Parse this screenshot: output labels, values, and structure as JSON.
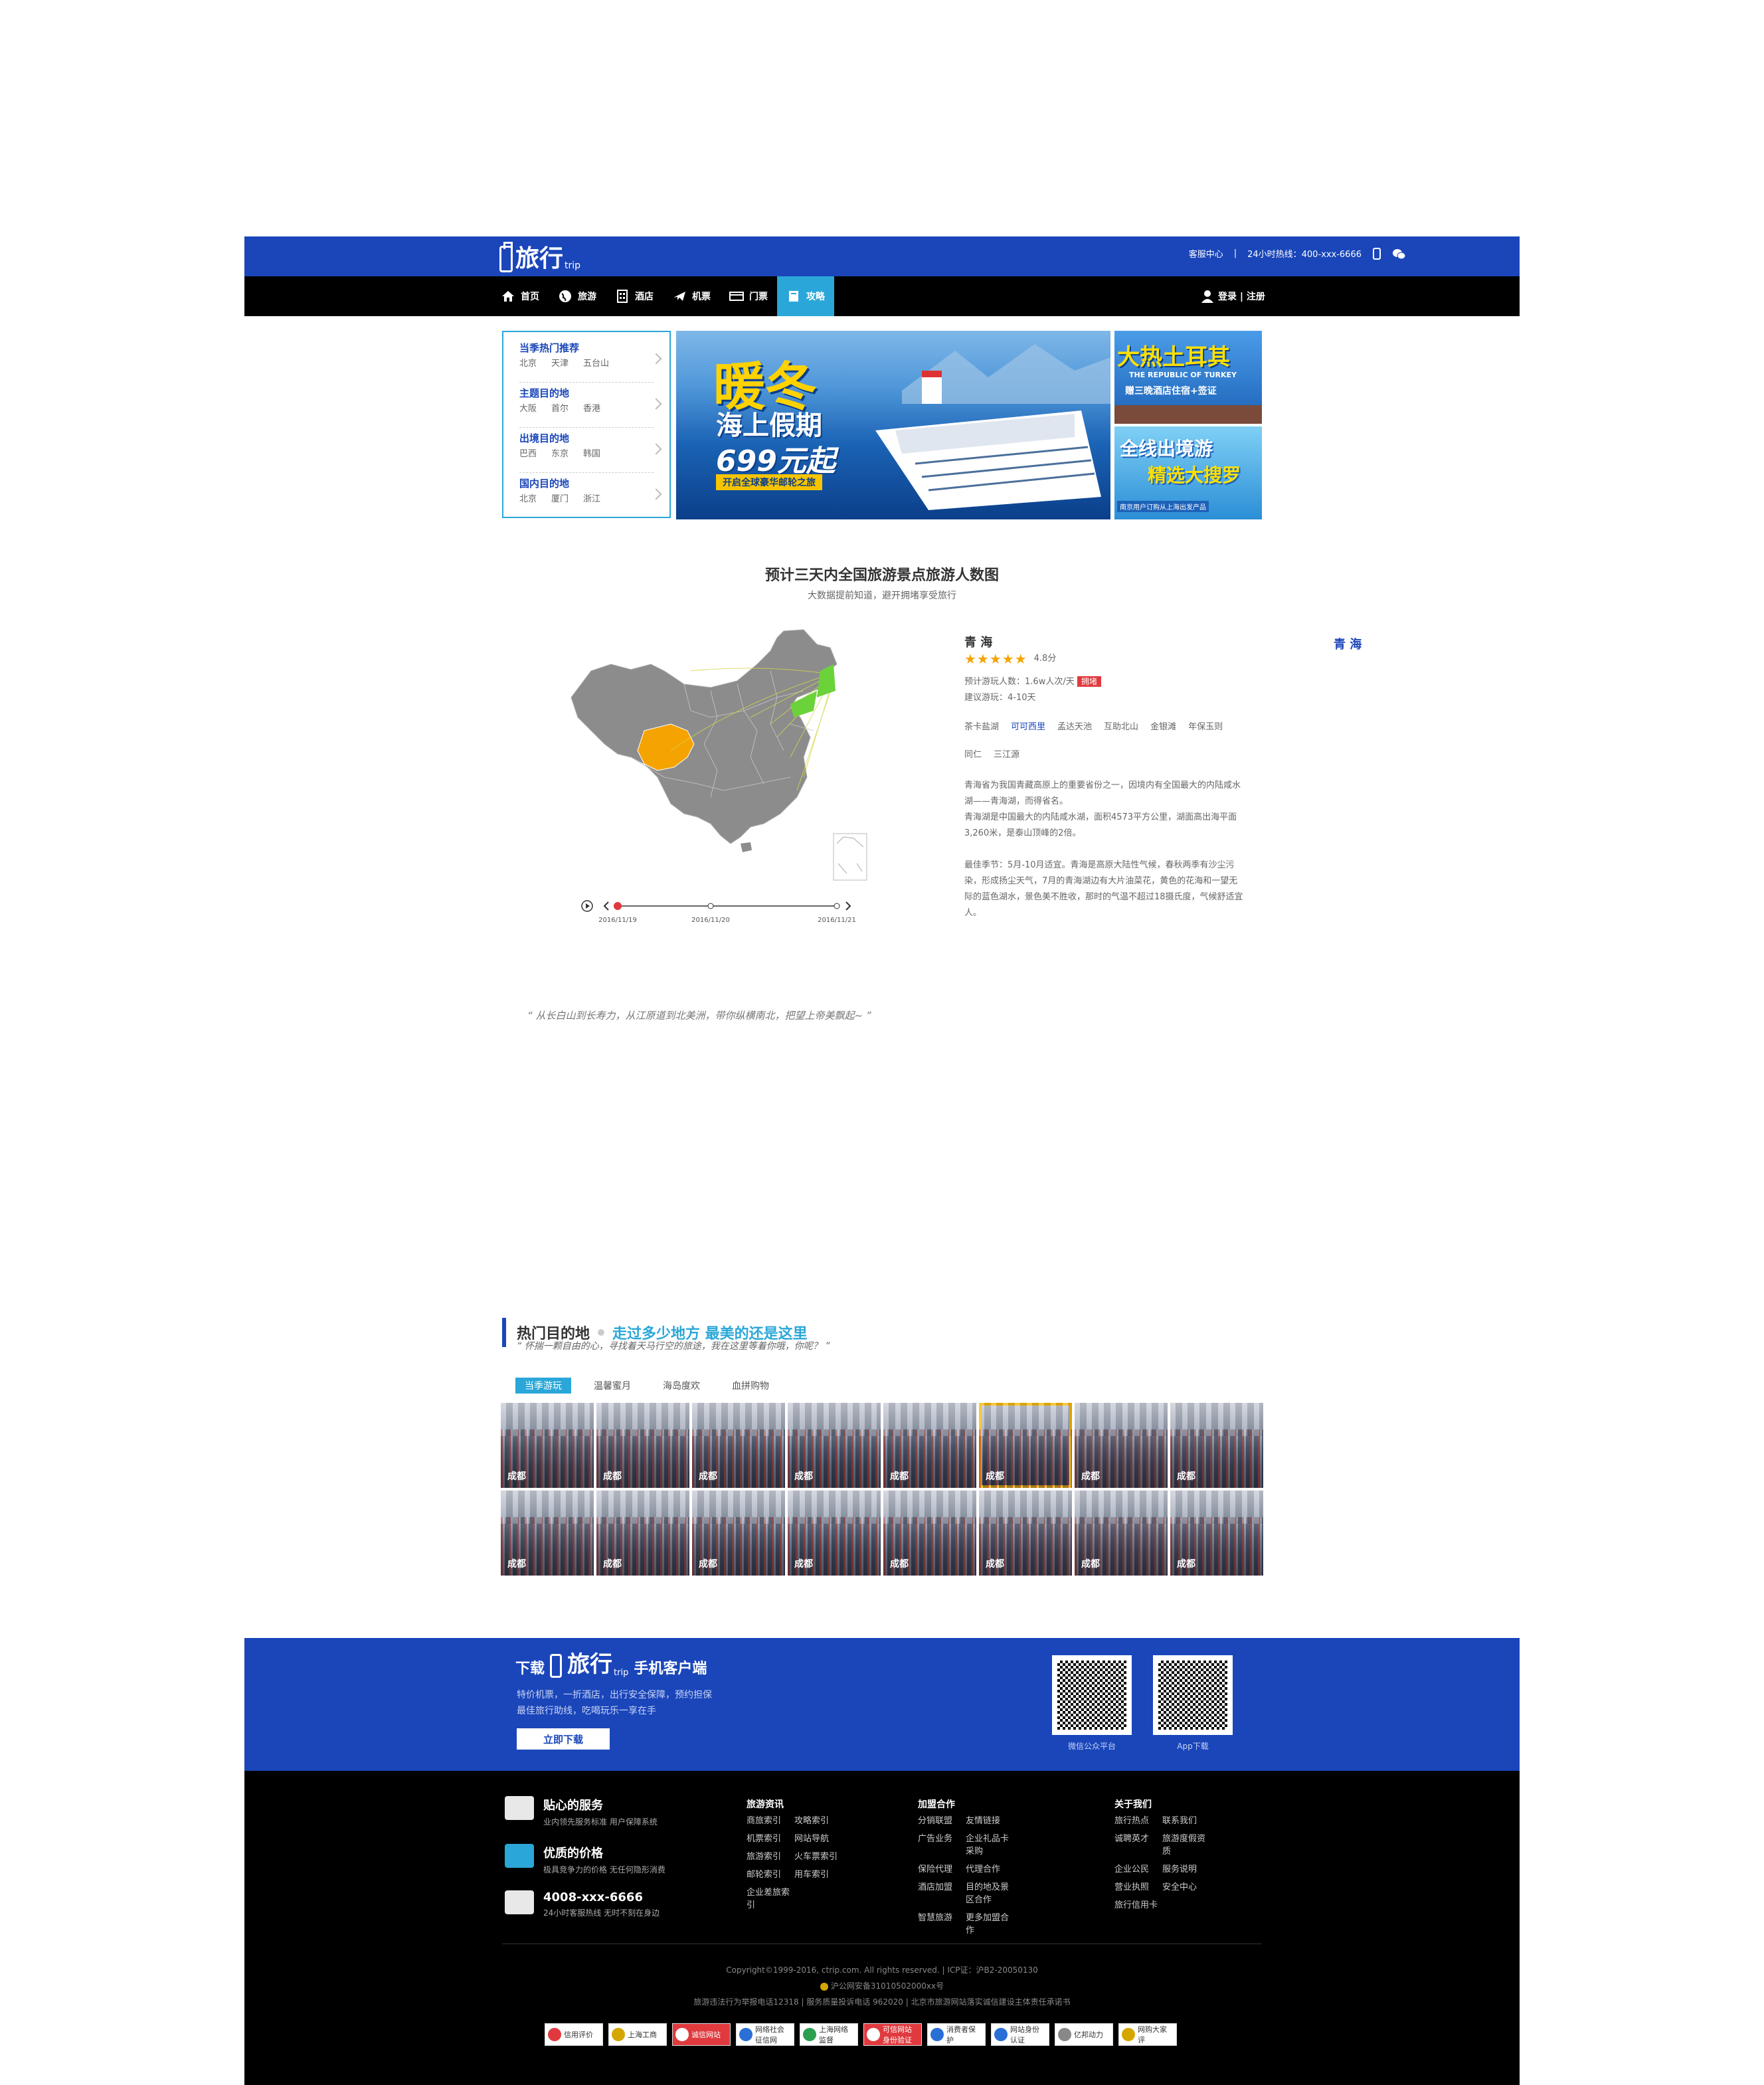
{
  "header": {
    "logo_name": "旅行",
    "logo_sub": "trip",
    "service_center": "客服中心",
    "separator": "|",
    "hotline": "24小时热线：400-xxx-6666"
  },
  "nav": {
    "items": [
      {
        "label": "首页",
        "icon": "home-icon"
      },
      {
        "label": "旅游",
        "icon": "globe-icon"
      },
      {
        "label": "酒店",
        "icon": "hotel-icon"
      },
      {
        "label": "机票",
        "icon": "plane-icon"
      },
      {
        "label": "门票",
        "icon": "ticket-icon"
      },
      {
        "label": "攻略",
        "icon": "book-icon",
        "active": true
      }
    ],
    "login": "登录 | 注册"
  },
  "categories": [
    {
      "title": "当季热门推荐",
      "cities": [
        "北京",
        "天津",
        "五台山"
      ]
    },
    {
      "title": "主题目的地",
      "cities": [
        "大阪",
        "首尔",
        "香港"
      ]
    },
    {
      "title": "出境目的地",
      "cities": [
        "巴西",
        "东京",
        "韩国"
      ]
    },
    {
      "title": "国内目的地",
      "cities": [
        "北京",
        "厦门",
        "浙江"
      ]
    }
  ],
  "banner": {
    "headline": "暖冬",
    "subline": "海上假期",
    "price": "699元起",
    "tagline": "开启全球豪华邮轮之旅"
  },
  "side_banners": [
    {
      "title": "大热土耳其",
      "sub": "THE REPUBLIC OF TURKEY",
      "note": "赠三晚酒店住宿+签证"
    },
    {
      "title": "全线出境游",
      "sub": "精选大搜罗",
      "note": "南京用户订购从上海出发产品"
    }
  ],
  "map_section": {
    "title": "预计三天内全国旅游景点旅游人数图",
    "subtitle": "大数据提前知道，避开拥堵享受旅行",
    "timeline_dates": [
      "2016/11/19",
      "2016/11/20",
      "2016/11/21"
    ],
    "selected_province": "青海",
    "right_label": "青 海"
  },
  "info": {
    "province": "青 海",
    "rating_stars": "★★★★★",
    "rating": "4.8分",
    "visitors_label": "预计游玩人数：",
    "visitors": "1.6w人次/天",
    "crowd_tag": "拥堵",
    "duration": "建议游玩：4-10天",
    "spots": [
      "茶卡盐湖",
      "可可西里",
      "孟达天池",
      "互助北山",
      "金银滩",
      "年保玉则",
      "同仁",
      "三江源"
    ],
    "selected_spot": "可可西里",
    "desc1": "青海省为我国青藏高原上的重要省份之一，因境内有全国最大的内陆咸水湖——青海湖，而得省名。",
    "desc2": "青海湖是中国最大的内陆咸水湖，面积4573平方公里，湖面高出海平面3,260米，是泰山顶峰的2倍。",
    "desc3": "最佳季节：5月-10月适宜。青海是高原大陆性气候，春秋两季有沙尘污染，形成扬尘天气，7月的青海湖边有大片油菜花，黄色的花海和一望无际的蓝色湖水，景色美不胜收，那时的气温不超过18摄氏度，气候舒适宜人。"
  },
  "quote": "“ 从长白山到长寿力，从江原道到北美洲，带你纵横南北，把望上帝美飘起~ ”",
  "hot": {
    "title": "热门目的地",
    "slogan": "走过多少地方 最美的还是这里",
    "sub": "“ 怀揣一颗自由的心，寻找着天马行空的旅途，我在这里等着你哦，你呢？ ”",
    "tabs": [
      "当季游玩",
      "温馨蜜月",
      "海岛度欢",
      "血拼购物"
    ],
    "tiles": [
      "成都",
      "成都",
      "成都",
      "成都",
      "成都",
      "成都",
      "成都",
      "成都",
      "成都",
      "成都",
      "成都",
      "成都",
      "成都",
      "成都",
      "成都",
      "成都"
    ],
    "highlighted_index": 5
  },
  "app": {
    "download": "下载",
    "client": "手机客户端",
    "desc1": "特价机票，一折酒店，出行安全保障，预约担保",
    "desc2": "最佳旅行助线，吃喝玩乐一享在手",
    "button": "立即下载",
    "qr1_label": "微信公众平台",
    "qr2_label": "App下载"
  },
  "footer": {
    "services": [
      {
        "title": "贴心的服务",
        "desc": "业内领先服务标准  用户保障系统",
        "color": "#e8e8e8"
      },
      {
        "title": "优质的价格",
        "desc": "极具竞争力的价格  无任何隐形消费",
        "color": "#2aa7d8"
      },
      {
        "title": "4008-xxx-6666",
        "desc": "24小时客服热线  无时不刻在身边",
        "color": "#e8e8e8"
      }
    ],
    "columns": [
      {
        "title": "旅游资讯",
        "items": [
          "商旅索引",
          "攻略索引",
          "机票索引",
          "网站导航",
          "旅游索引",
          "火车票索引",
          "邮轮索引",
          "用车索引",
          "企业差旅索引"
        ]
      },
      {
        "title": "加盟合作",
        "items": [
          "分销联盟",
          "友情链接",
          "广告业务",
          "企业礼品卡采购",
          "保险代理",
          "代理合作",
          "酒店加盟",
          "目的地及景区合作",
          "智慧旅游",
          "更多加盟合作"
        ]
      },
      {
        "title": "关于我们",
        "items": [
          "旅行热点",
          "联系我们",
          "诚聘英才",
          "旅游度假资质",
          "企业公民",
          "服务说明",
          "营业执照",
          "安全中心",
          "旅行信用卡"
        ]
      }
    ],
    "copyright": "Copyright©1999-2016, ctrip.com. All rights reserved. | ICP证：沪B2-20050130",
    "police": "沪公网安备31010502000xx号",
    "complaint": "旅游违法行为举报电话12318 | 服务质量投诉电话 962020 | 北京市旅游网站落实诚信建设主体责任承诺书",
    "badges": [
      "信用评价",
      "上海工商",
      "诚信网站",
      "网络社会征信网",
      "上海网络监督",
      "可信网站身份验证",
      "消费者保护",
      "网站身份认证",
      "亿邦动力",
      "网购大家评"
    ]
  }
}
